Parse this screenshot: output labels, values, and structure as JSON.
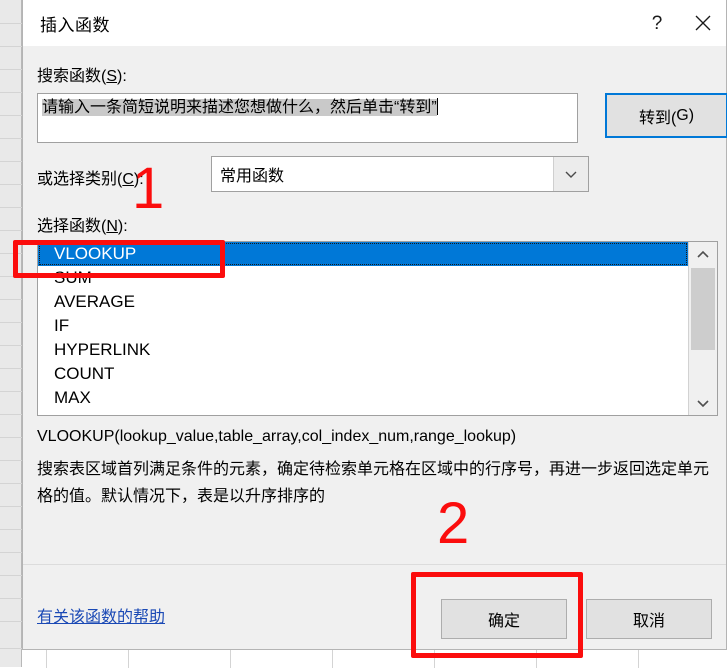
{
  "window": {
    "title": "插入函数",
    "help_button": "?",
    "close_button": "✕"
  },
  "search": {
    "label_prefix": "搜索函数(",
    "label_accel": "S",
    "label_suffix": "):",
    "value": "请输入一条简短说明来描述您想做什么，然后单击“转到”",
    "placeholder": "请输入一条简短说明来描述您想做什么，然后单击“转到”",
    "go_button": {
      "prefix": "转到(",
      "accel": "G",
      "suffix": ")"
    }
  },
  "category": {
    "label_prefix": "或选择类别(",
    "label_accel": "C",
    "label_suffix": "):",
    "selected": "常用函数",
    "options": [
      "常用函数"
    ]
  },
  "function_list": {
    "label_prefix": "选择函数(",
    "label_accel": "N",
    "label_suffix": "):",
    "items": [
      {
        "name": "VLOOKUP",
        "selected": true
      },
      {
        "name": "SUM",
        "selected": false
      },
      {
        "name": "AVERAGE",
        "selected": false
      },
      {
        "name": "IF",
        "selected": false
      },
      {
        "name": "HYPERLINK",
        "selected": false
      },
      {
        "name": "COUNT",
        "selected": false
      },
      {
        "name": "MAX",
        "selected": false
      }
    ]
  },
  "details": {
    "signature": "VLOOKUP(lookup_value,table_array,col_index_num,range_lookup)",
    "description": "搜索表区域首列满足条件的元素，确定待检索单元格在区域中的行序号，再进一步返回选定单元格的值。默认情况下，表是以升序排序的"
  },
  "footer": {
    "help_link": "有关该函数的帮助",
    "ok_button": "确定",
    "cancel_button": "取消"
  },
  "annotations": {
    "step_one": "1",
    "step_two": "2",
    "color": "#fb0d0d"
  },
  "colors": {
    "accent": "#0078d7",
    "dialog_bg": "#f0f0f0",
    "annotation_red": "#fb0d0d",
    "link_blue": "#1a49b5"
  }
}
